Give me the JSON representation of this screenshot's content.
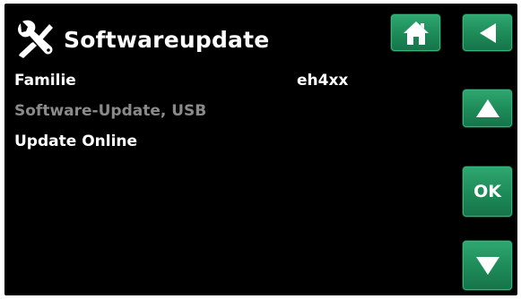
{
  "header": {
    "title": "Softwareupdate",
    "icon": "wrench-screwdriver-icon"
  },
  "menu": {
    "familie_label": "Familie",
    "familie_value": "eh4xx",
    "usb_label": "Software-Update, USB",
    "online_label": "Update Online"
  },
  "buttons": {
    "home_icon": "home-icon",
    "back_icon": "arrow-left-icon",
    "up_icon": "arrow-up-icon",
    "ok_label": "OK",
    "down_icon": "arrow-down-icon"
  },
  "colors": {
    "background": "#000000",
    "text": "#ffffff",
    "disabled_text": "#8a8a8a",
    "button_green": "#1d8a58"
  }
}
